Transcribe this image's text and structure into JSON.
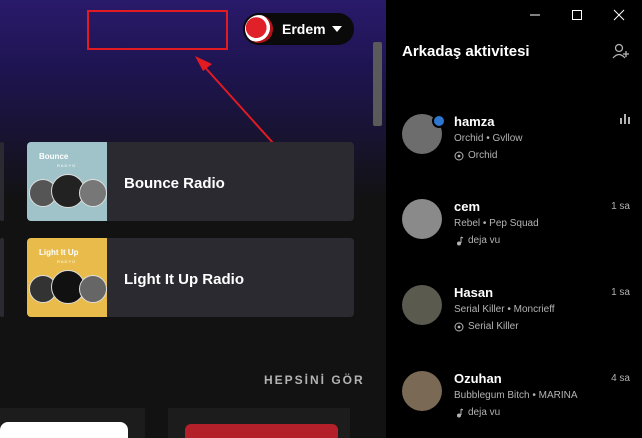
{
  "profile": {
    "name": "Erdem"
  },
  "cards": [
    {
      "title": "Bounce Radio",
      "art_label": "Bounce",
      "art_sub": "RADYO",
      "art_color": "#9fc3c8"
    },
    {
      "title": "Light It Up Radio",
      "art_label": "Light It Up",
      "art_sub": "RADYO",
      "art_color": "#e8bb4a"
    }
  ],
  "see_all": "HEPSİNİ GÖR",
  "side": {
    "title": "Arkadaş aktivitesi",
    "friends": [
      {
        "name": "hamza",
        "track": "Orchid • Gvllow",
        "context": "Orchid",
        "context_icon": "radio-icon",
        "time": "",
        "status": "playing-now",
        "avatar_color": "#6d6d6d"
      },
      {
        "name": "cem",
        "track": "Rebel • Pep Squad",
        "context": "deja vu",
        "context_icon": "music-note-icon",
        "time": "1 sa",
        "status": "",
        "avatar_color": "#8a8a8a"
      },
      {
        "name": "Hasan",
        "track": "Serial Killer • Moncrieff",
        "context": "Serial Killer",
        "context_icon": "radio-icon",
        "time": "1 sa",
        "status": "",
        "avatar_color": "#5b5a4e"
      },
      {
        "name": "Ozuhan",
        "track": "Bubblegum Bitch • MARINA",
        "context": "deja vu",
        "context_icon": "music-note-icon",
        "time": "4 sa",
        "status": "",
        "avatar_color": "#7a6a55"
      }
    ]
  },
  "window_controls": [
    "minimize-icon",
    "maximize-icon",
    "close-icon"
  ]
}
